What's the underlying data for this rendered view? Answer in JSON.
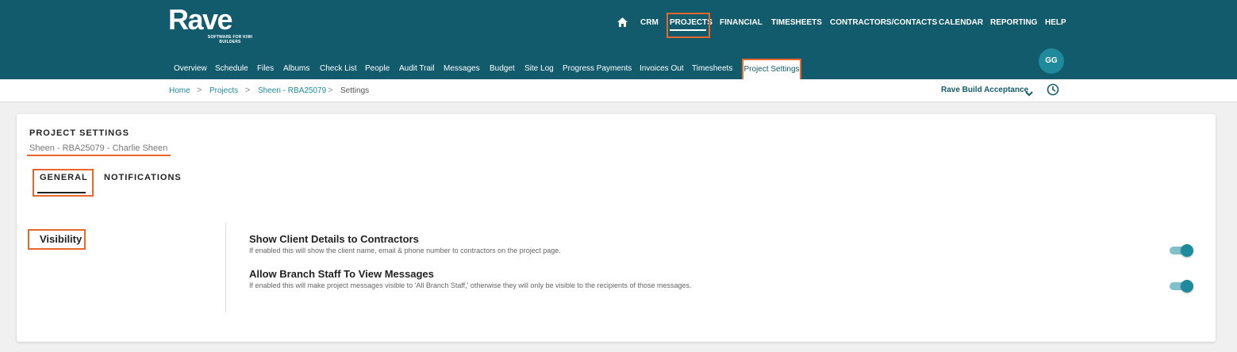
{
  "brand": {
    "logo_text": "Rave",
    "tagline": "SOFTWARE FOR KIWI BUILDERS"
  },
  "main_nav": {
    "home_icon": "home-icon",
    "items": [
      "CRM",
      "PROJECTS",
      "FINANCIAL",
      "TIMESHEETS",
      "CONTRACTORS/CONTACTS",
      "CALENDAR",
      "REPORTING",
      "HELP"
    ],
    "active": "PROJECTS"
  },
  "sub_nav": {
    "items": [
      "Overview",
      "Schedule",
      "Files",
      "Albums",
      "Check List",
      "People",
      "Audit Trail",
      "Messages",
      "Budget",
      "Site Log",
      "Progress Payments",
      "Invoices Out",
      "Timesheets"
    ],
    "active_label": "Project Settings"
  },
  "user": {
    "initials": "GG"
  },
  "breadcrumb": {
    "items": [
      "Home",
      "Projects",
      "Sheen - RBA25079",
      "Settings"
    ],
    "separator": ">"
  },
  "project_switcher": {
    "label": "Rave Build Acceptance",
    "icon": "chevron-down-icon"
  },
  "history_icon": "clock-icon",
  "page": {
    "title": "PROJECT SETTINGS",
    "project_name": "Sheen - RBA25079 - Charlie Sheen",
    "tabs": [
      "GENERAL",
      "NOTIFICATIONS"
    ],
    "active_tab": "GENERAL"
  },
  "section": {
    "label": "Visibility",
    "settings": [
      {
        "title": "Show Client Details to Contractors",
        "description": "If enabled this will show the client name, email & phone number to contractors on the project page.",
        "enabled": true
      },
      {
        "title": "Allow Branch Staff To View Messages",
        "description": "If enabled this will make project messages visible to 'All Branch Staff,' otherwise they will only be visible to the recipients of those messages.",
        "enabled": true
      }
    ]
  },
  "colors": {
    "header_bg": "#115b6c",
    "accent": "#1e8a9c",
    "annotation": "#e8682c"
  }
}
